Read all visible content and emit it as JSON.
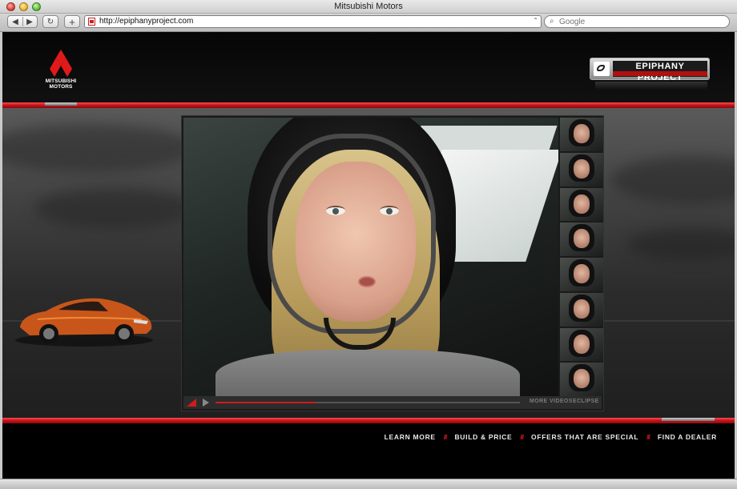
{
  "window": {
    "title": "Mitsubishi Motors"
  },
  "toolbar": {
    "back_glyph": "◀",
    "forward_glyph": "▶",
    "reload_glyph": "↻",
    "add_glyph": "+",
    "url": "http://epiphanyproject.com",
    "search_placeholder": "Google"
  },
  "header": {
    "logo_text_1": "MITSUBISHI",
    "logo_text_2": "MOTORS",
    "badge_text": "EPIPHANY PROJECT"
  },
  "player": {
    "progress": 0.33,
    "more_videos": "MORE VIDEOS",
    "eclipse": "ECLIPSE",
    "thumbnail_count": 8
  },
  "nav": {
    "items": [
      "LEARN MORE",
      "BUILD & PRICE",
      "OFFERS THAT ARE SPECIAL",
      "FIND A DEALER"
    ],
    "separator": "///"
  },
  "colors": {
    "brand_red": "#c5121a",
    "background": "#000000"
  }
}
